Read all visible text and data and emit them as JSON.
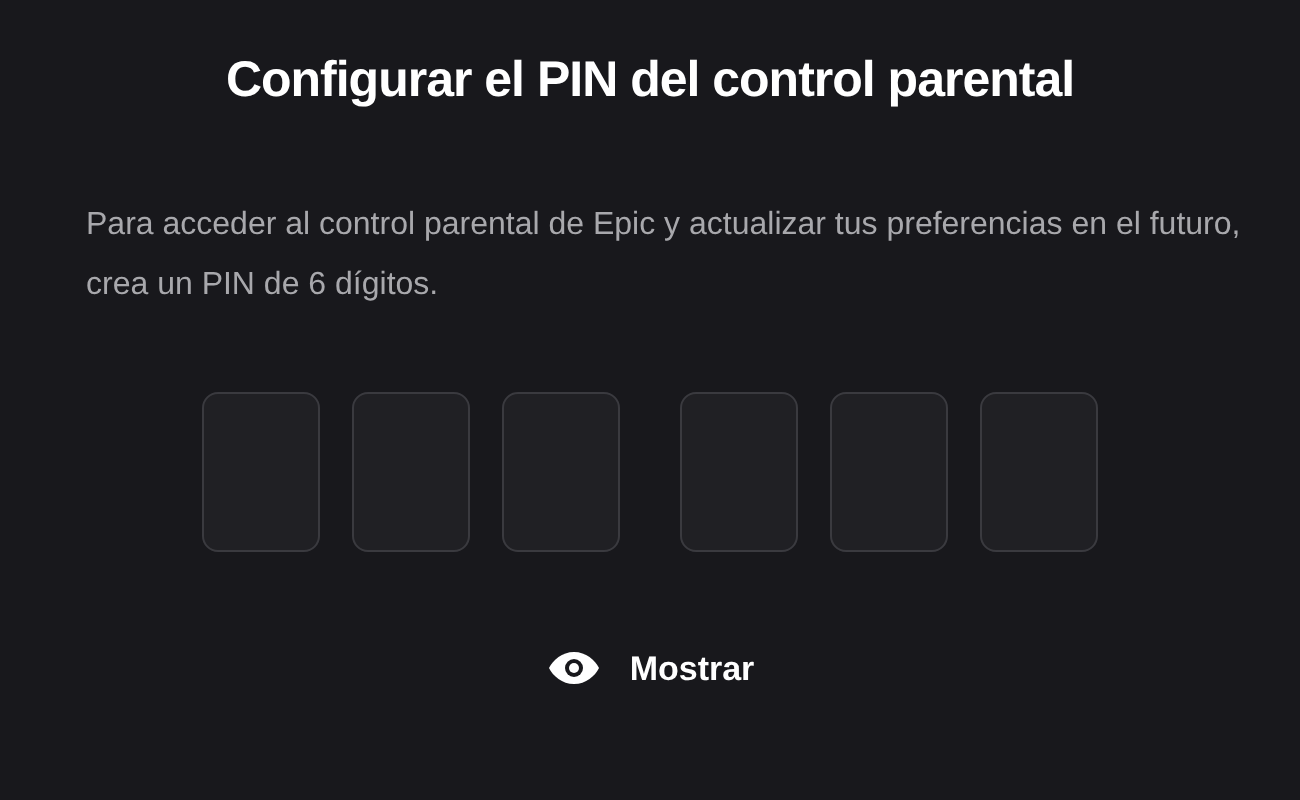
{
  "title": "Configurar el PIN del control parental",
  "description": "Para acceder al control parental de Epic y actualizar tus preferencias en el futuro, crea un PIN de 6 dígitos.",
  "pin_groups": [
    {
      "fields": [
        {
          "filled": false
        },
        {
          "filled": false
        },
        {
          "filled": false
        }
      ]
    },
    {
      "fields": [
        {
          "filled": false
        },
        {
          "filled": false
        },
        {
          "filled": false
        }
      ]
    }
  ],
  "show_button": {
    "label": "Mostrar"
  }
}
